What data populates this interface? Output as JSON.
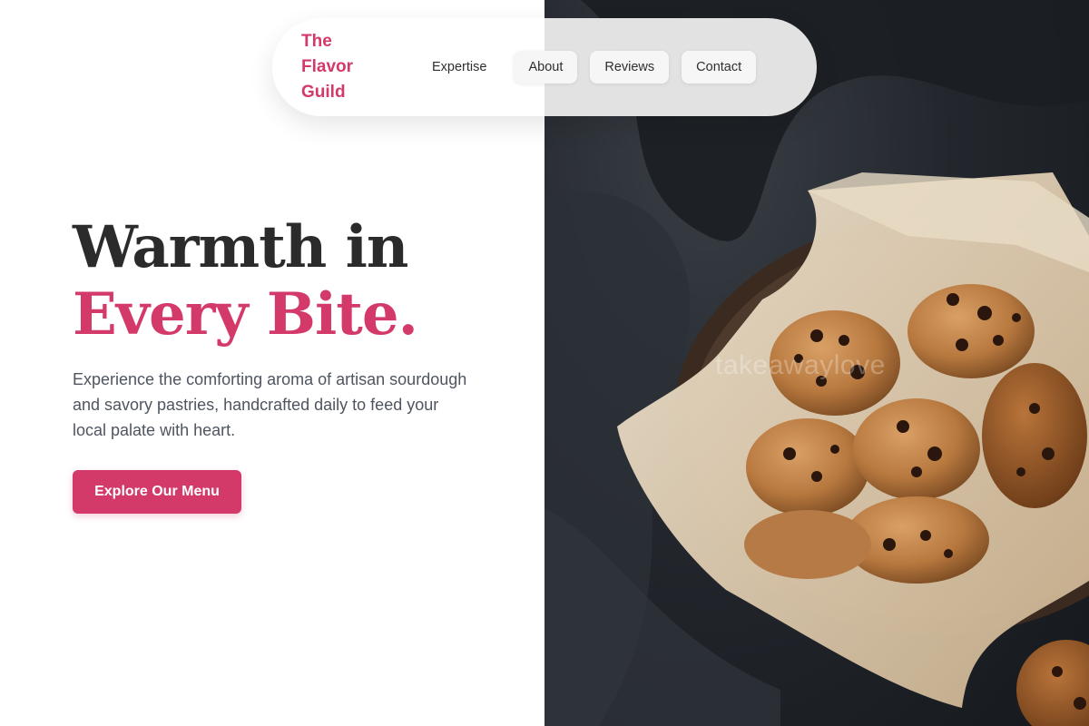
{
  "brand": {
    "lines": [
      "The",
      "Flavor",
      "Guild"
    ]
  },
  "nav": {
    "items": [
      "Expertise",
      "About",
      "Reviews",
      "Contact"
    ]
  },
  "hero": {
    "headline_line1": "Warmth in",
    "headline_line2": "Every Bite.",
    "subtext": "Experience the comforting aroma of artisan sourdough and savory pastries, handcrafted daily to feed your local palate with heart.",
    "cta_label": "Explore Our Menu"
  },
  "image": {
    "watermark": "takeawaylove"
  },
  "colors": {
    "accent": "#d33a6a",
    "heading": "#2b2b2b",
    "body_text": "#4f5560",
    "background": "#ffffff"
  }
}
